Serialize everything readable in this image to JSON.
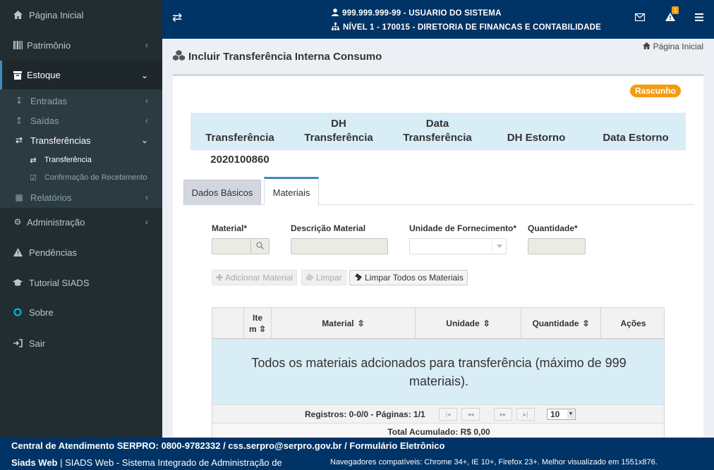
{
  "sidebar": {
    "items": [
      {
        "label": "Página Inicial",
        "icon": "home-icon"
      },
      {
        "label": "Patrimônio",
        "icon": "barcode-icon"
      },
      {
        "label": "Estoque",
        "icon": "archive-icon"
      },
      {
        "label": "Administração",
        "icon": "gears-icon"
      },
      {
        "label": "Pendências",
        "icon": "warning-icon"
      },
      {
        "label": "Tutorial SIADS",
        "icon": "graduation-cap-icon"
      },
      {
        "label": "Sobre",
        "icon": "circle-icon"
      },
      {
        "label": "Sair",
        "icon": "sign-out-icon"
      }
    ],
    "estoque_sub": [
      {
        "label": "Entradas"
      },
      {
        "label": "Saídas"
      },
      {
        "label": "Transferências"
      },
      {
        "label": "Relatórios"
      }
    ],
    "transfer_sub": [
      {
        "label": "Transferência"
      },
      {
        "label": "Confirmação de Recebimento"
      }
    ]
  },
  "topbar": {
    "user": "999.999.999-99 - USUARIO DO SISTEMA",
    "level": "NÍVEL 1 - 170015 - DIRETORIA DE FINANCAS E CONTABILIDADE",
    "alert_count": "1"
  },
  "page": {
    "title": "Incluir Transferência Interna Consumo",
    "breadcrumb": "Página Inicial",
    "status_badge": "Rascunho"
  },
  "summary": {
    "headers": [
      "Transferência",
      "DH Transferência",
      "Data Transferência",
      "DH Estorno",
      "Data Estorno"
    ],
    "headers_line1": [
      "",
      "DH",
      "Data",
      "",
      ""
    ],
    "headers_line2": [
      "Transferência",
      "Transferência",
      "Transferência",
      "DH Estorno",
      "Data Estorno"
    ],
    "transfer_number": "2020100860"
  },
  "tabs": [
    {
      "label": "Dados Básicos"
    },
    {
      "label": "Materiais"
    }
  ],
  "form": {
    "material_label": "Material*",
    "descricao_label": "Descrição Material",
    "unidade_label": "Unidade de Fornecimento*",
    "quantidade_label": "Quantidade*",
    "add_button": "Adicionar Material",
    "clear_button": "Limpar",
    "clear_all_button": "Limpar Todos os Materiais"
  },
  "table": {
    "col_item_line1": "Ite",
    "col_item_line2": "m",
    "col_material": "Material",
    "col_unidade": "Unidade",
    "col_quantidade": "Quantidade",
    "col_acoes": "Ações",
    "empty_message": "Todos os materiais adcionados para transferência (máximo de 999 materiais).",
    "records": "Registros: 0-0/0 - Páginas: 1/1",
    "page_size": "10",
    "total": "Total Acumulado: R$ 0,00"
  },
  "footer": {
    "line1": "Central de Atendimento SERPRO: 0800-9782332 / css.serpro@serpro.gov.br / Formulário Eletrônico",
    "brand": "Siads Web",
    "line2": "| SIADS Web - Sistema Integrado de Administração de",
    "browsers": "Navegadores compatíveis: Chrome 34+, IE 10+, Firefox 23+. Melhor visualizado em 1551x876."
  },
  "colors": {
    "topbar": "#003366",
    "sidebar": "#222d32",
    "badge": "#f39c12",
    "summary_header": "#d9edf7",
    "accent": "#3c8dbc"
  }
}
